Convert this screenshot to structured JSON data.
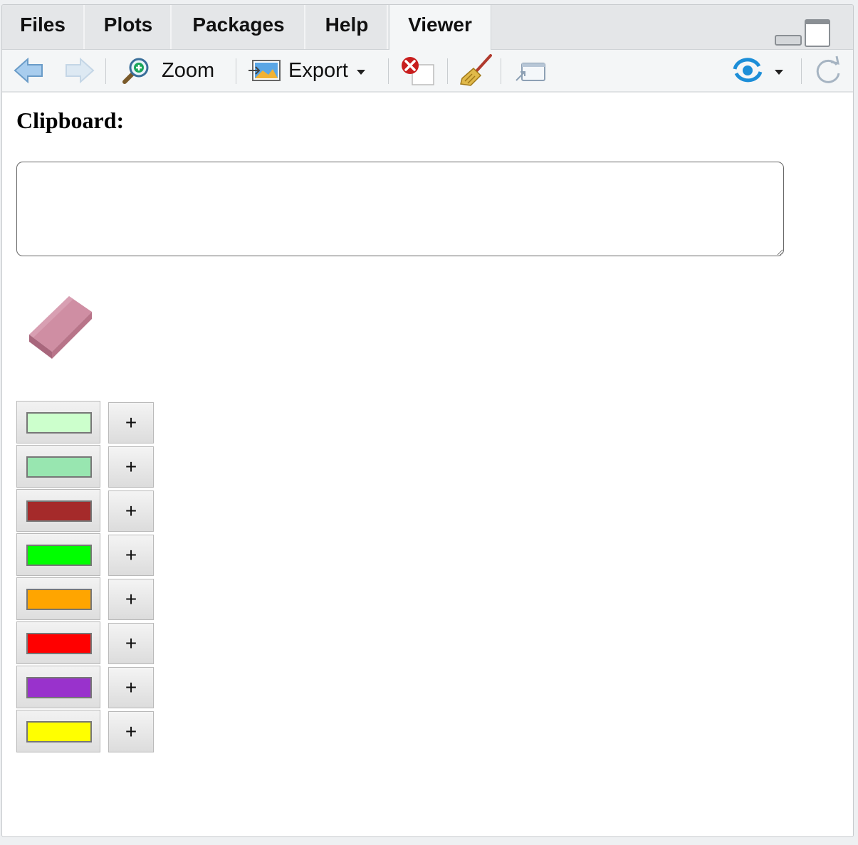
{
  "tabs": [
    {
      "label": "Files"
    },
    {
      "label": "Plots"
    },
    {
      "label": "Packages"
    },
    {
      "label": "Help"
    },
    {
      "label": "Viewer"
    }
  ],
  "active_tab": "Viewer",
  "toolbar": {
    "zoom_label": "Zoom",
    "export_label": "Export",
    "icons": [
      "back-arrow-icon",
      "forward-arrow-icon",
      "zoom-icon",
      "export-icon",
      "remove-viewer-icon",
      "clear-broom-icon",
      "popout-icon",
      "publish-icon",
      "refresh-icon"
    ]
  },
  "content": {
    "clipboard_heading": "Clipboard:",
    "clipboard_value": "",
    "eraser_icon": "eraser-icon",
    "plus_label": "+",
    "colors": [
      "#ccffcc",
      "#98e6b0",
      "#a52a2a",
      "#00ff00",
      "#ffa500",
      "#ff0000",
      "#9932cc",
      "#ffff00"
    ]
  }
}
